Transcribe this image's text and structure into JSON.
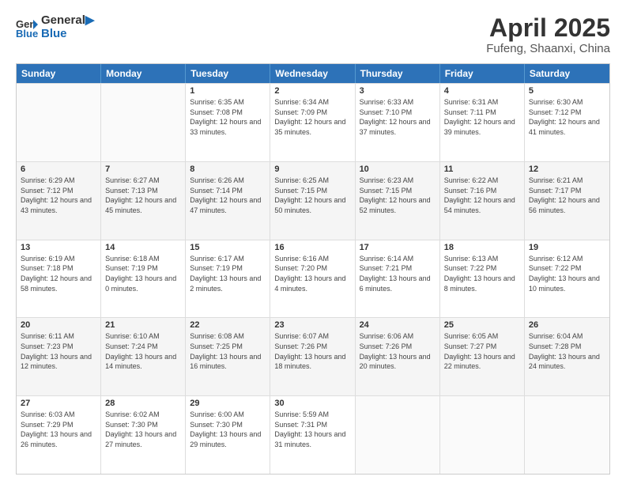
{
  "header": {
    "logo_line1": "General",
    "logo_line2": "Blue",
    "month": "April 2025",
    "location": "Fufeng, Shaanxi, China"
  },
  "weekdays": [
    "Sunday",
    "Monday",
    "Tuesday",
    "Wednesday",
    "Thursday",
    "Friday",
    "Saturday"
  ],
  "weeks": [
    [
      {
        "day": "",
        "sunrise": "",
        "sunset": "",
        "daylight": ""
      },
      {
        "day": "",
        "sunrise": "",
        "sunset": "",
        "daylight": ""
      },
      {
        "day": "1",
        "sunrise": "Sunrise: 6:35 AM",
        "sunset": "Sunset: 7:08 PM",
        "daylight": "Daylight: 12 hours and 33 minutes."
      },
      {
        "day": "2",
        "sunrise": "Sunrise: 6:34 AM",
        "sunset": "Sunset: 7:09 PM",
        "daylight": "Daylight: 12 hours and 35 minutes."
      },
      {
        "day": "3",
        "sunrise": "Sunrise: 6:33 AM",
        "sunset": "Sunset: 7:10 PM",
        "daylight": "Daylight: 12 hours and 37 minutes."
      },
      {
        "day": "4",
        "sunrise": "Sunrise: 6:31 AM",
        "sunset": "Sunset: 7:11 PM",
        "daylight": "Daylight: 12 hours and 39 minutes."
      },
      {
        "day": "5",
        "sunrise": "Sunrise: 6:30 AM",
        "sunset": "Sunset: 7:12 PM",
        "daylight": "Daylight: 12 hours and 41 minutes."
      }
    ],
    [
      {
        "day": "6",
        "sunrise": "Sunrise: 6:29 AM",
        "sunset": "Sunset: 7:12 PM",
        "daylight": "Daylight: 12 hours and 43 minutes."
      },
      {
        "day": "7",
        "sunrise": "Sunrise: 6:27 AM",
        "sunset": "Sunset: 7:13 PM",
        "daylight": "Daylight: 12 hours and 45 minutes."
      },
      {
        "day": "8",
        "sunrise": "Sunrise: 6:26 AM",
        "sunset": "Sunset: 7:14 PM",
        "daylight": "Daylight: 12 hours and 47 minutes."
      },
      {
        "day": "9",
        "sunrise": "Sunrise: 6:25 AM",
        "sunset": "Sunset: 7:15 PM",
        "daylight": "Daylight: 12 hours and 50 minutes."
      },
      {
        "day": "10",
        "sunrise": "Sunrise: 6:23 AM",
        "sunset": "Sunset: 7:15 PM",
        "daylight": "Daylight: 12 hours and 52 minutes."
      },
      {
        "day": "11",
        "sunrise": "Sunrise: 6:22 AM",
        "sunset": "Sunset: 7:16 PM",
        "daylight": "Daylight: 12 hours and 54 minutes."
      },
      {
        "day": "12",
        "sunrise": "Sunrise: 6:21 AM",
        "sunset": "Sunset: 7:17 PM",
        "daylight": "Daylight: 12 hours and 56 minutes."
      }
    ],
    [
      {
        "day": "13",
        "sunrise": "Sunrise: 6:19 AM",
        "sunset": "Sunset: 7:18 PM",
        "daylight": "Daylight: 12 hours and 58 minutes."
      },
      {
        "day": "14",
        "sunrise": "Sunrise: 6:18 AM",
        "sunset": "Sunset: 7:19 PM",
        "daylight": "Daylight: 13 hours and 0 minutes."
      },
      {
        "day": "15",
        "sunrise": "Sunrise: 6:17 AM",
        "sunset": "Sunset: 7:19 PM",
        "daylight": "Daylight: 13 hours and 2 minutes."
      },
      {
        "day": "16",
        "sunrise": "Sunrise: 6:16 AM",
        "sunset": "Sunset: 7:20 PM",
        "daylight": "Daylight: 13 hours and 4 minutes."
      },
      {
        "day": "17",
        "sunrise": "Sunrise: 6:14 AM",
        "sunset": "Sunset: 7:21 PM",
        "daylight": "Daylight: 13 hours and 6 minutes."
      },
      {
        "day": "18",
        "sunrise": "Sunrise: 6:13 AM",
        "sunset": "Sunset: 7:22 PM",
        "daylight": "Daylight: 13 hours and 8 minutes."
      },
      {
        "day": "19",
        "sunrise": "Sunrise: 6:12 AM",
        "sunset": "Sunset: 7:22 PM",
        "daylight": "Daylight: 13 hours and 10 minutes."
      }
    ],
    [
      {
        "day": "20",
        "sunrise": "Sunrise: 6:11 AM",
        "sunset": "Sunset: 7:23 PM",
        "daylight": "Daylight: 13 hours and 12 minutes."
      },
      {
        "day": "21",
        "sunrise": "Sunrise: 6:10 AM",
        "sunset": "Sunset: 7:24 PM",
        "daylight": "Daylight: 13 hours and 14 minutes."
      },
      {
        "day": "22",
        "sunrise": "Sunrise: 6:08 AM",
        "sunset": "Sunset: 7:25 PM",
        "daylight": "Daylight: 13 hours and 16 minutes."
      },
      {
        "day": "23",
        "sunrise": "Sunrise: 6:07 AM",
        "sunset": "Sunset: 7:26 PM",
        "daylight": "Daylight: 13 hours and 18 minutes."
      },
      {
        "day": "24",
        "sunrise": "Sunrise: 6:06 AM",
        "sunset": "Sunset: 7:26 PM",
        "daylight": "Daylight: 13 hours and 20 minutes."
      },
      {
        "day": "25",
        "sunrise": "Sunrise: 6:05 AM",
        "sunset": "Sunset: 7:27 PM",
        "daylight": "Daylight: 13 hours and 22 minutes."
      },
      {
        "day": "26",
        "sunrise": "Sunrise: 6:04 AM",
        "sunset": "Sunset: 7:28 PM",
        "daylight": "Daylight: 13 hours and 24 minutes."
      }
    ],
    [
      {
        "day": "27",
        "sunrise": "Sunrise: 6:03 AM",
        "sunset": "Sunset: 7:29 PM",
        "daylight": "Daylight: 13 hours and 26 minutes."
      },
      {
        "day": "28",
        "sunrise": "Sunrise: 6:02 AM",
        "sunset": "Sunset: 7:30 PM",
        "daylight": "Daylight: 13 hours and 27 minutes."
      },
      {
        "day": "29",
        "sunrise": "Sunrise: 6:00 AM",
        "sunset": "Sunset: 7:30 PM",
        "daylight": "Daylight: 13 hours and 29 minutes."
      },
      {
        "day": "30",
        "sunrise": "Sunrise: 5:59 AM",
        "sunset": "Sunset: 7:31 PM",
        "daylight": "Daylight: 13 hours and 31 minutes."
      },
      {
        "day": "",
        "sunrise": "",
        "sunset": "",
        "daylight": ""
      },
      {
        "day": "",
        "sunrise": "",
        "sunset": "",
        "daylight": ""
      },
      {
        "day": "",
        "sunrise": "",
        "sunset": "",
        "daylight": ""
      }
    ]
  ]
}
